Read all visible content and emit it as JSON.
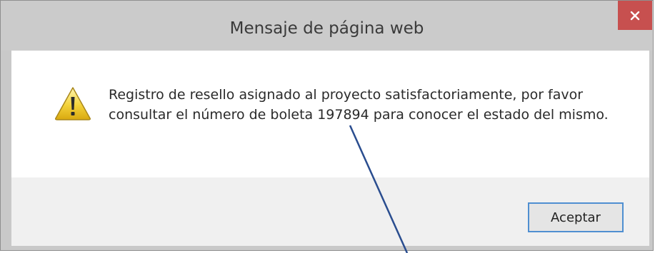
{
  "dialog": {
    "title": "Mensaje de página web",
    "close_icon": "close-icon",
    "message_icon": "warning-icon",
    "message": "Registro de resello asignado al proyecto satisfactoriamente, por favor consultar el número de boleta 197894 para conocer el estado del mismo.",
    "ok_label": "Aceptar"
  },
  "colors": {
    "close_button": "#c7504f",
    "title_bar": "#cbcbcb",
    "footer": "#f0f0f0",
    "button_focus_border": "#4f8fd1",
    "annotation_line": "#2a4d8f"
  }
}
